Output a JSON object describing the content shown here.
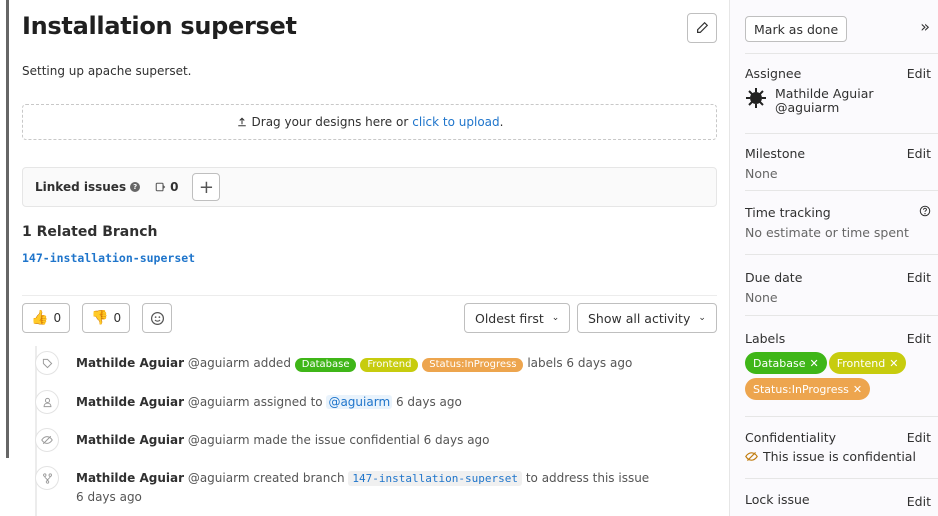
{
  "issue": {
    "title": "Installation superset",
    "description": "Setting up apache superset."
  },
  "designs": {
    "text": "Drag your designs here or",
    "link": "click to upload",
    "suffix": "."
  },
  "linked_issues": {
    "label": "Linked issues",
    "count": "0"
  },
  "related": {
    "title": "1 Related Branch",
    "branch": "147-installation-superset"
  },
  "reactions": {
    "thumbs_up": "0",
    "thumbs_down": "0"
  },
  "sort": {
    "order": "Oldest first",
    "filter": "Show all activity"
  },
  "activity": [
    {
      "author": "Mathilde Aguiar",
      "handle": "@aguiarm",
      "before": "added",
      "labels": [
        "Database",
        "Frontend",
        "Status:InProgress"
      ],
      "after": "labels 6 days ago"
    },
    {
      "author": "Mathilde Aguiar",
      "handle": "@aguiarm",
      "before": "assigned to",
      "mention": "@aguiarm",
      "after": "6 days ago"
    },
    {
      "author": "Mathilde Aguiar",
      "handle": "@aguiarm",
      "before": "made the issue confidential 6 days ago"
    },
    {
      "author": "Mathilde Aguiar",
      "handle": "@aguiarm",
      "before": "created branch",
      "branch": "147-installation-superset",
      "after": "to address this issue",
      "time": "6 days ago"
    }
  ],
  "sidebar": {
    "mark_done": "Mark as done",
    "collapse": "»",
    "edit": "Edit",
    "assignee": {
      "title": "Assignee",
      "name": "Mathilde Aguiar",
      "handle": "@aguiarm"
    },
    "milestone": {
      "title": "Milestone",
      "value": "None"
    },
    "time_tracking": {
      "title": "Time tracking",
      "value": "No estimate or time spent"
    },
    "due_date": {
      "title": "Due date",
      "value": "None"
    },
    "labels": {
      "title": "Labels",
      "items": [
        "Database",
        "Frontend",
        "Status:InProgress"
      ]
    },
    "confidentiality": {
      "title": "Confidentiality",
      "value": "This issue is confidential"
    },
    "lock": {
      "title": "Lock issue"
    }
  },
  "colors": {
    "database": "#3fb618",
    "frontend": "#c7cc0e",
    "status": "#eda54e",
    "link": "#1f75cb"
  }
}
